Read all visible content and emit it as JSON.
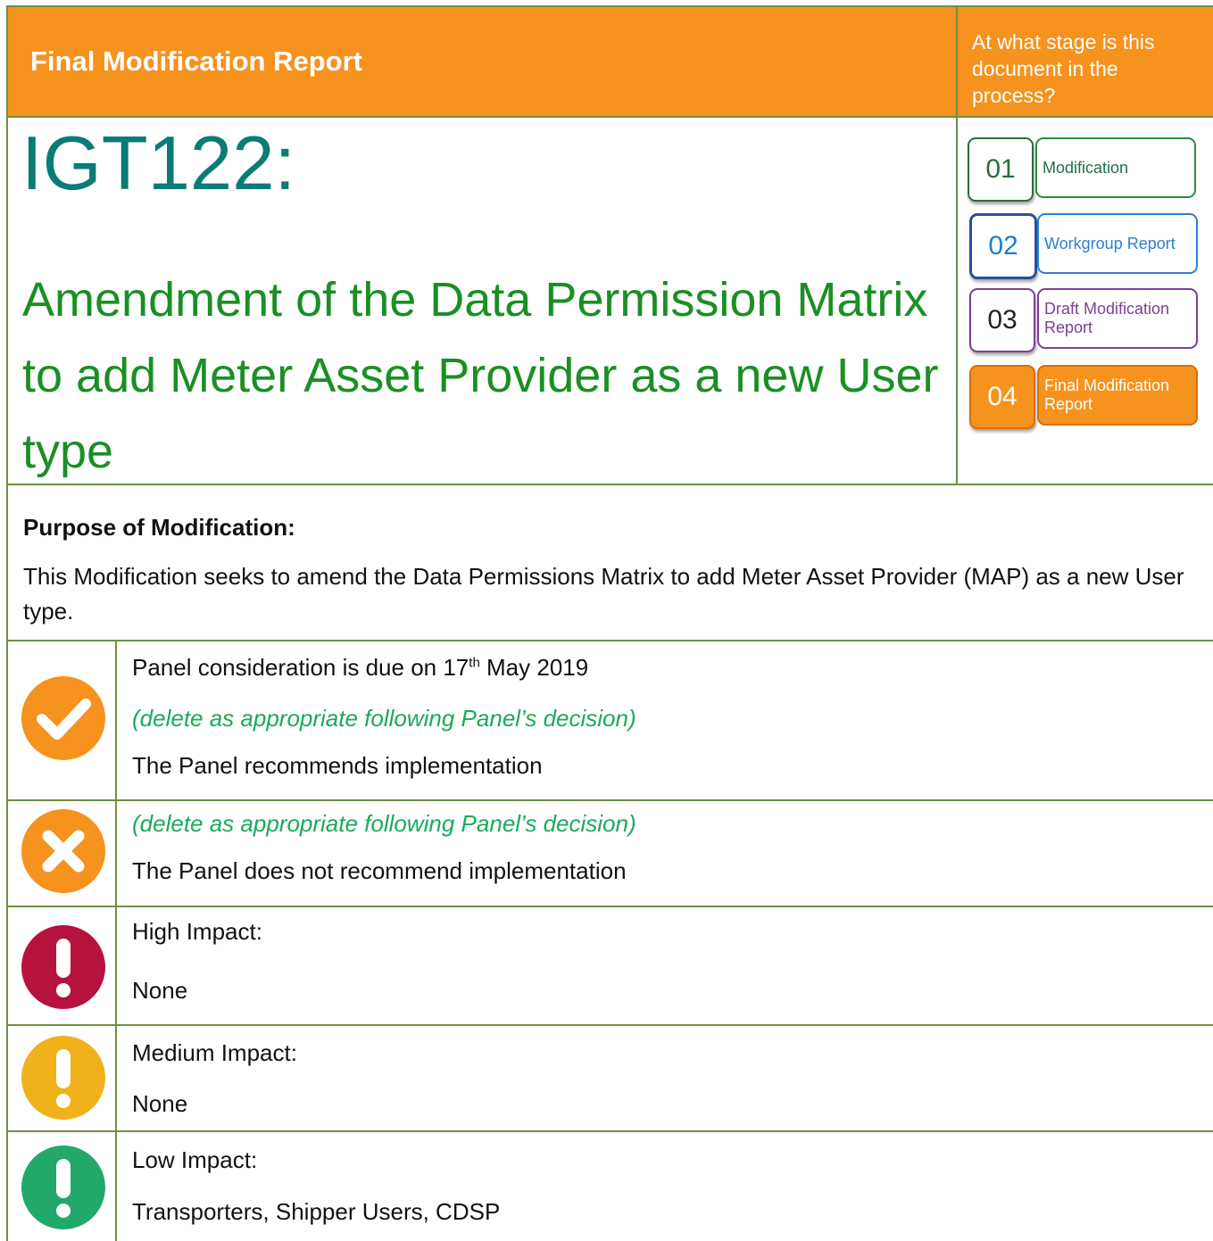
{
  "header": {
    "title": "Final Modification Report",
    "stage_question": "At what stage is this document in the process?"
  },
  "document": {
    "id": "IGT122:",
    "title": "Amendment of the Data Permission Matrix to add Meter Asset Provider as a new User type"
  },
  "stages": [
    {
      "number": "01",
      "label": "Modification",
      "color": "#2e8b3e",
      "active": false
    },
    {
      "number": "02",
      "label": "Workgroup Report",
      "color": "#2b7fd6",
      "active": false
    },
    {
      "number": "03",
      "label": "Draft Modification Report",
      "color": "#7b3f9a",
      "active": false
    },
    {
      "number": "04",
      "label": "Final Modification Report",
      "color": "#f6921e",
      "active": true
    }
  ],
  "purpose": {
    "heading": "Purpose of Modification:",
    "text": "This Modification seeks to amend the Data Permissions Matrix to add Meter Asset Provider (MAP) as a new User type."
  },
  "panel": {
    "due_prefix": "Panel consideration is due on 17",
    "due_sup": "th",
    "due_suffix": " May 2019",
    "delete_note": "(delete as appropriate following Panel’s decision)",
    "recommend": "The Panel recommends implementation",
    "not_recommend": "The Panel does not recommend implementation"
  },
  "impacts": {
    "high_label": "High Impact:",
    "high_value": "None",
    "medium_label": "Medium Impact:",
    "medium_value": "None",
    "low_label": "Low Impact:",
    "low_value": "Transporters, Shipper Users, CDSP"
  },
  "colors": {
    "accent_orange": "#f6921e",
    "teal": "#0a7c74",
    "title_green": "#1a8f24",
    "high_red": "#b5123e",
    "medium_yellow": "#f0b21b",
    "low_green": "#22a86a"
  }
}
